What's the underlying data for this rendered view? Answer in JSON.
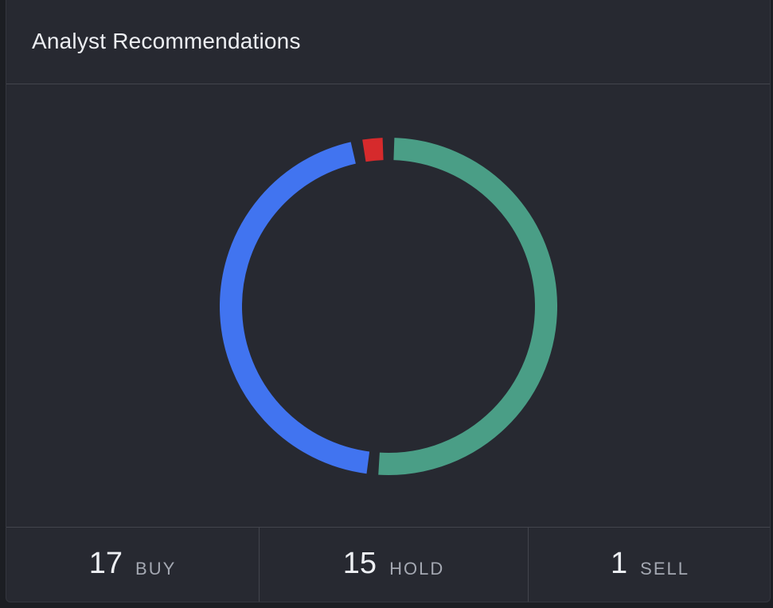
{
  "card": {
    "title": "Analyst Recommendations"
  },
  "summary": [
    {
      "count": "17",
      "label": "BUY"
    },
    {
      "count": "15",
      "label": "HOLD"
    },
    {
      "count": "1",
      "label": "SELL"
    }
  ],
  "colors": {
    "buy": "#4a9e86",
    "hold": "#4174f0",
    "sell": "#d62a2c",
    "background": "#272931"
  },
  "chart_data": {
    "type": "pie",
    "variant": "donut",
    "categories": [
      "BUY",
      "HOLD",
      "SELL"
    ],
    "values": [
      17,
      15,
      1
    ],
    "title": "Analyst Recommendations"
  }
}
